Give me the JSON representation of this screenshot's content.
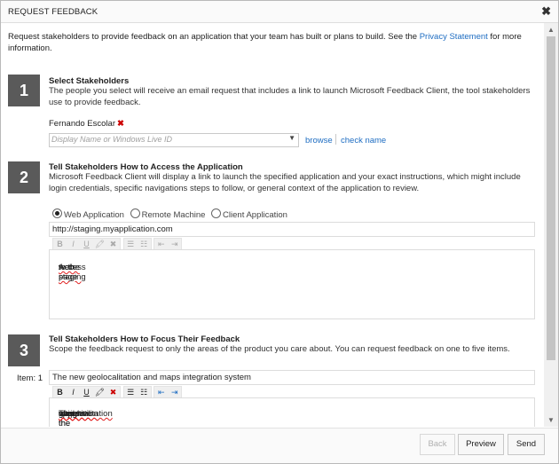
{
  "dialog": {
    "title": "REQUEST FEEDBACK",
    "close_glyph": "✖"
  },
  "intro": {
    "text": "Request stakeholders to provide feedback on an application that your team has built or plans to build. See the ",
    "link": "Privacy Statement",
    "text_after": " for more information."
  },
  "step1": {
    "number": "1",
    "heading": "Select Stakeholders",
    "description": "The people you select will receive an email request that includes a link to launch Microsoft Feedback Client, the tool stakeholders use to provide feedback.",
    "selected_stakeholder": "Fernando Escolar",
    "remove_glyph": "✖",
    "input_placeholder": "Display Name or Windows Live ID",
    "dropdown_glyph": "▼",
    "browse_link": "browse",
    "check_name_link": "check name"
  },
  "step2": {
    "number": "2",
    "heading": "Tell Stakeholders How to Access the Application",
    "description": "Microsoft Feedback Client will display a link to launch the specified application and your exact instructions, which might include login credentials, specific navigations steps to follow, or general context of the application to review.",
    "radio_options": [
      "Web Application",
      "Remote Machine",
      "Client Application"
    ],
    "selected_radio": "Web Application",
    "url_value": "http://staging.myapplication.com",
    "instructions_parts": [
      "Access ",
      "to the staging",
      " web page"
    ]
  },
  "step3": {
    "number": "3",
    "heading": "Tell Stakeholders How to Focus Their Feedback",
    "description": "Scope the feedback request to only the areas of the product you care about. You can request feedback on one to five items.",
    "item_label": "Item: 1",
    "item_title_value": "The new geolocalitation and maps integration system",
    "item_detail_parts": [
      "The",
      " ",
      "geolocalitation",
      " ",
      "an",
      " ",
      "google",
      " ",
      "maps",
      " ",
      "integration",
      " was the main ",
      "objective",
      " of the ",
      "current",
      " ",
      "sprint",
      "."
    ]
  },
  "toolbar": {
    "bold": "B",
    "italic": "I",
    "underline": "U",
    "highlight": "🖍",
    "clear": "✖",
    "bullets": "☰",
    "numbers": "☷",
    "outdent": "⇤",
    "indent": "⇥"
  },
  "footer": {
    "back": "Back",
    "preview": "Preview",
    "send": "Send"
  },
  "scrollbar": {
    "up_glyph": "▲",
    "down_glyph": "▼"
  },
  "colors": {
    "link": "#1e6dc2",
    "step_badge": "#5a5a5a",
    "remove_x": "#cc0000",
    "spellcheck": "#e02020"
  }
}
